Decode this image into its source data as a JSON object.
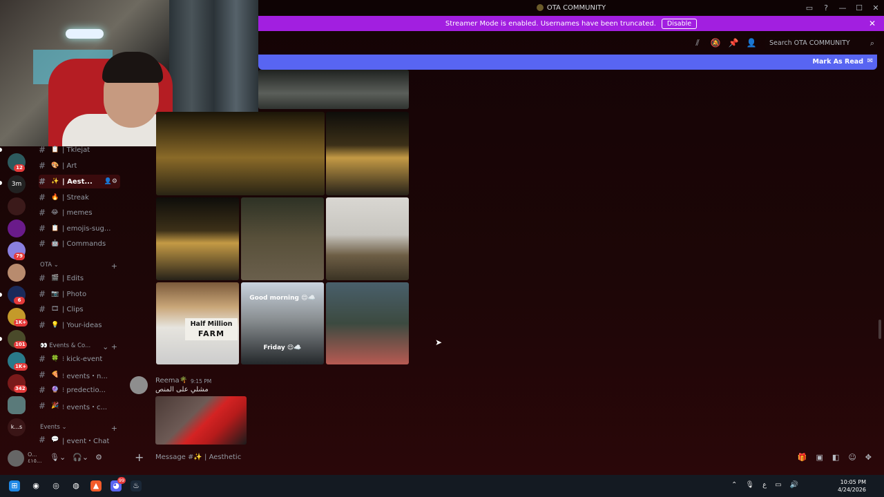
{
  "window": {
    "title": "OTA COMMUNITY",
    "controls": [
      "▭",
      "?",
      "—",
      "☐",
      "✕"
    ]
  },
  "streamer": {
    "message": "Streamer Mode is enabled. Usernames have been truncated.",
    "disable_label": "Disable",
    "close": "✕"
  },
  "header": {
    "search_placeholder": "Search OTA COMMUNITY",
    "icons": [
      "threads-icon",
      "mute-icon",
      "pin-icon",
      "members-icon"
    ]
  },
  "mark_read": {
    "label": "Mark As Read"
  },
  "servers": {
    "badges": [
      "12",
      "79",
      "6",
      "1K+",
      "101",
      "1K+",
      "342"
    ],
    "last_label": "k...s"
  },
  "channels": {
    "group1": [
      {
        "emoji": "📋",
        "name": "| Tklejat"
      },
      {
        "emoji": "🎨",
        "name": "| Art"
      },
      {
        "emoji": "✨",
        "name": "| Aest...",
        "active": true
      },
      {
        "emoji": "🔥",
        "name": "| Streak"
      },
      {
        "emoji": "😂",
        "name": "| memes"
      },
      {
        "emoji": "📋",
        "name": "| emojis-sug..."
      },
      {
        "emoji": "🤖",
        "name": "| Commands"
      }
    ],
    "cat_ota": "OTA",
    "group2": [
      {
        "emoji": "🎬",
        "name": "| Edits"
      },
      {
        "emoji": "📷",
        "name": "| Photo"
      },
      {
        "emoji": "🎞",
        "name": "| Clips"
      },
      {
        "emoji": "💡",
        "name": "| Your-ideas"
      }
    ],
    "cat_events_co": "Events & Co...",
    "group3": [
      {
        "emoji": "🍀",
        "name": "⁝ kick-event"
      },
      {
        "emoji": "🍕",
        "name": "⁝ events・n..."
      },
      {
        "emoji": "🔮",
        "name": "⁝ predectio..."
      },
      {
        "emoji": "🎉",
        "name": "⁝ events・c..."
      }
    ],
    "cat_events": "Events",
    "group4": [
      {
        "emoji": "💬",
        "name": "| event・Chat"
      }
    ]
  },
  "user": {
    "name": "O...",
    "status": "٤١٥..."
  },
  "images": {
    "greeting_top": "Good morning 😌☁️",
    "greeting_bottom": "Friday 😌☁️",
    "farm_line1": "Half Million",
    "farm_line2": "FARM"
  },
  "message": {
    "author": "Reema",
    "time": "9:15 PM",
    "text": "مشلي على المنص"
  },
  "composer": {
    "placeholder": "Message #✨ | Aesthetic"
  },
  "taskbar": {
    "time": "10:05 PM",
    "date": "4/24/2026",
    "lang": "ع",
    "discord_badge": "99"
  }
}
